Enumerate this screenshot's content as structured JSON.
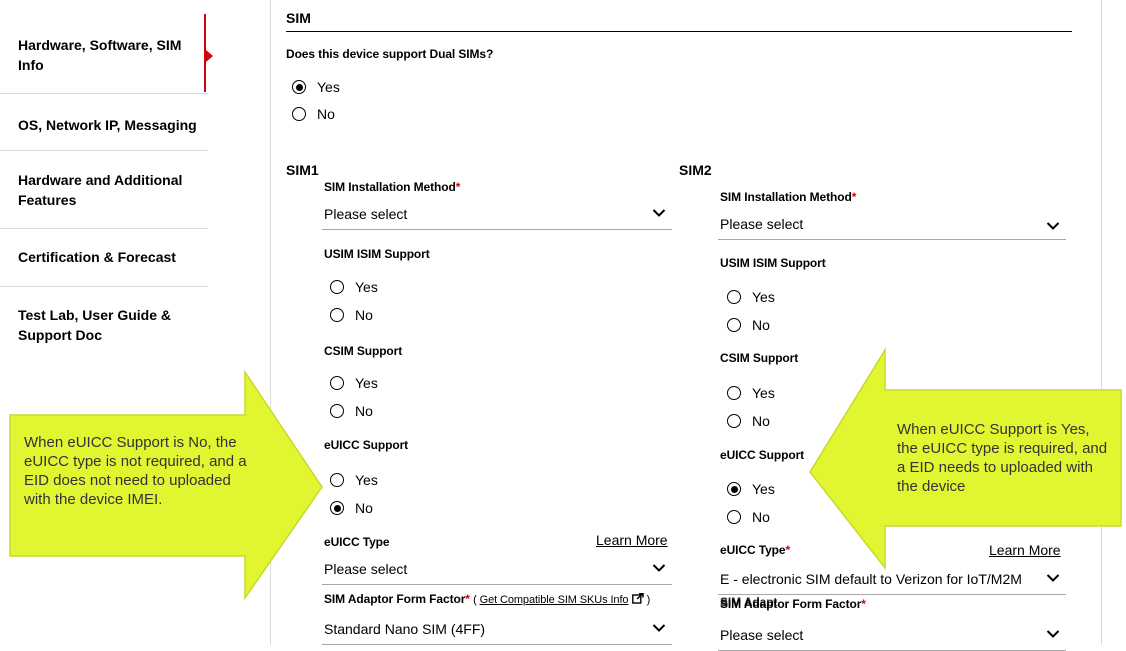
{
  "sidebar": {
    "items": [
      {
        "label": "Hardware, Software, SIM Info"
      },
      {
        "label": "OS, Network IP, Messaging"
      },
      {
        "label": "Hardware and Additional Features"
      },
      {
        "label": "Certification & Forecast"
      },
      {
        "label": "Test Lab, User Guide & Support Doc"
      }
    ],
    "active_color": "#cd040b"
  },
  "form": {
    "section_title": "SIM",
    "dual_sim_question": "Does this device support Dual SIMs?",
    "dual_sim_options": [
      "Yes",
      "No"
    ],
    "dual_sim_selected": "Yes",
    "sim1": {
      "heading": "SIM1",
      "install_method_label": "SIM Installation Method",
      "install_method_value": "Please select",
      "usim_label": "USIM ISIM Support",
      "usim_options": [
        "Yes",
        "No"
      ],
      "csim_label": "CSIM Support",
      "csim_options": [
        "Yes",
        "No"
      ],
      "euicc_label": "eUICC Support",
      "euicc_options": [
        "Yes",
        "No"
      ],
      "euicc_selected": "No",
      "euicc_type_label": "eUICC Type",
      "learn_more": "Learn More",
      "euicc_type_value": "Please select",
      "adaptor_label": "SIM Adaptor Form Factor",
      "adaptor_paren_open": "( ",
      "adaptor_link": "Get Compatible SIM SKUs Info",
      "adaptor_paren_close": " )",
      "adaptor_value": "Standard Nano SIM (4FF)"
    },
    "sim2": {
      "heading": "SIM2",
      "install_method_label": "SIM Installation Method",
      "install_method_value": "Please select",
      "usim_label": "USIM ISIM Support",
      "usim_options": [
        "Yes",
        "No"
      ],
      "csim_label": "CSIM Support",
      "csim_options": [
        "Yes",
        "No"
      ],
      "euicc_label": "eUICC Support",
      "euicc_options": [
        "Yes",
        "No"
      ],
      "euicc_selected": "Yes",
      "euicc_type_label": "eUICC Type",
      "learn_more": "Learn More",
      "euicc_type_value": "E - electronic SIM default to Verizon for IoT/M2M",
      "adaptor_overlap_text": "SIM Adapt",
      "adaptor_label": "SIM Adaptor Form Factor",
      "adaptor_value": "Please select"
    },
    "required_marker": "*"
  },
  "callouts": {
    "left": "When eUICC Support is No, the eUICC type is not required, and a EID does not need to uploaded with the device IMEI.",
    "right": "When eUICC Support is Yes, the eUICC type is required, and a EID needs to uploaded with the device",
    "color": "#e2f531"
  }
}
